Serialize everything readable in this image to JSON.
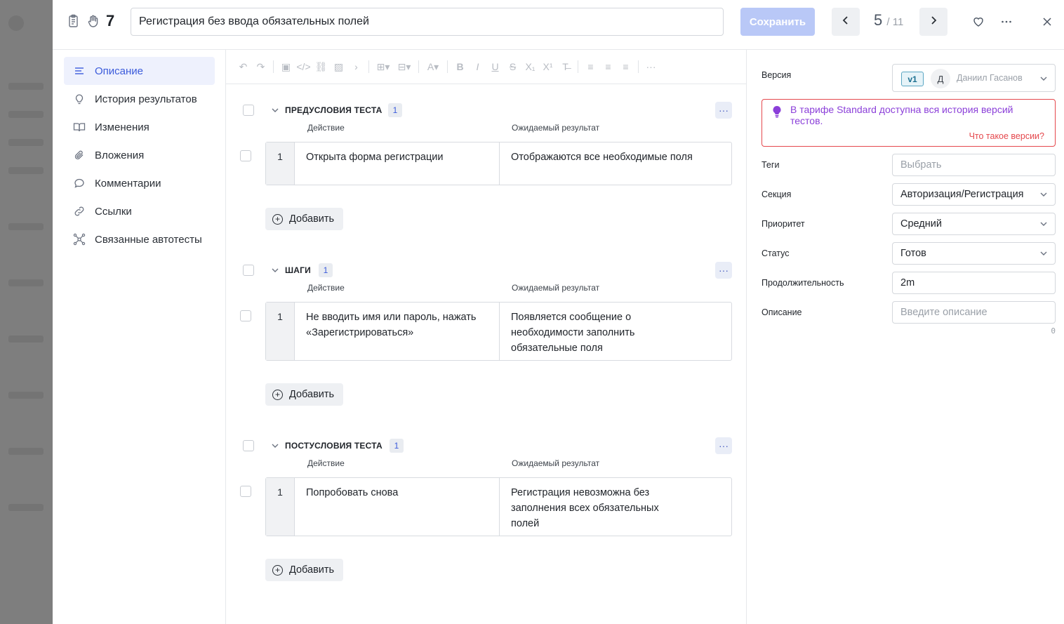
{
  "header": {
    "case_id": "7",
    "title": "Регистрация без ввода обязательных полей",
    "save_label": "Сохранить",
    "pager_current": "5",
    "pager_total": "/ 11"
  },
  "nav": {
    "items": [
      {
        "label": "Описание",
        "icon": "list-icon",
        "active": true
      },
      {
        "label": "История результатов",
        "icon": "bulb-icon"
      },
      {
        "label": "Изменения",
        "icon": "book-icon"
      },
      {
        "label": "Вложения",
        "icon": "paperclip-icon"
      },
      {
        "label": "Комментарии",
        "icon": "comment-icon"
      },
      {
        "label": "Ссылки",
        "icon": "link-icon"
      },
      {
        "label": "Связанные автотесты",
        "icon": "network-icon"
      }
    ]
  },
  "sections": [
    {
      "title": "ПРЕДУСЛОВИЯ ТЕСТА",
      "count": "1",
      "col_action": "Действие",
      "col_result": "Ожидаемый результат",
      "steps": [
        {
          "num": "1",
          "action": "Открыта форма регистрации",
          "result": "Отображаются все необходимые поля"
        }
      ],
      "add_label": "Добавить"
    },
    {
      "title": "ШАГИ",
      "count": "1",
      "col_action": "Действие",
      "col_result": "Ожидаемый результат",
      "steps": [
        {
          "num": "1",
          "action": "Не вводить имя или пароль, нажать «Зарегистрироваться»",
          "result": "Появляется сообщение о необходимости заполнить обязательные поля"
        }
      ],
      "add_label": "Добавить"
    },
    {
      "title": "ПОСТУСЛОВИЯ ТЕСТА",
      "count": "1",
      "col_action": "Действие",
      "col_result": "Ожидаемый результат",
      "steps": [
        {
          "num": "1",
          "action": "Попробовать снова",
          "result": "Регистрация невозможна без заполнения всех обязательных полей"
        }
      ],
      "add_label": "Добавить"
    }
  ],
  "right": {
    "version_label": "Версия",
    "version_badge": "v1",
    "version_avatar": "Д",
    "version_user": "Даниил Гасанов",
    "promo_text": "В тарифе Standard доступна вся история версий тестов.",
    "promo_link": "Что такое версии?",
    "tags_label": "Теги",
    "tags_placeholder": "Выбрать",
    "section_label": "Секция",
    "section_value": "Авторизация/Регистрация",
    "priority_label": "Приоритет",
    "priority_value": "Средний",
    "status_label": "Статус",
    "status_value": "Готов",
    "duration_label": "Продолжительность",
    "duration_value": "2m",
    "description_label": "Описание",
    "description_placeholder": "Введите описание",
    "description_count": "0"
  },
  "colors": {
    "accent": "#3b5bdb",
    "save_disabled": "#b9c8f7",
    "promo_border": "#e5484d",
    "promo_text": "#8b3fd9"
  }
}
